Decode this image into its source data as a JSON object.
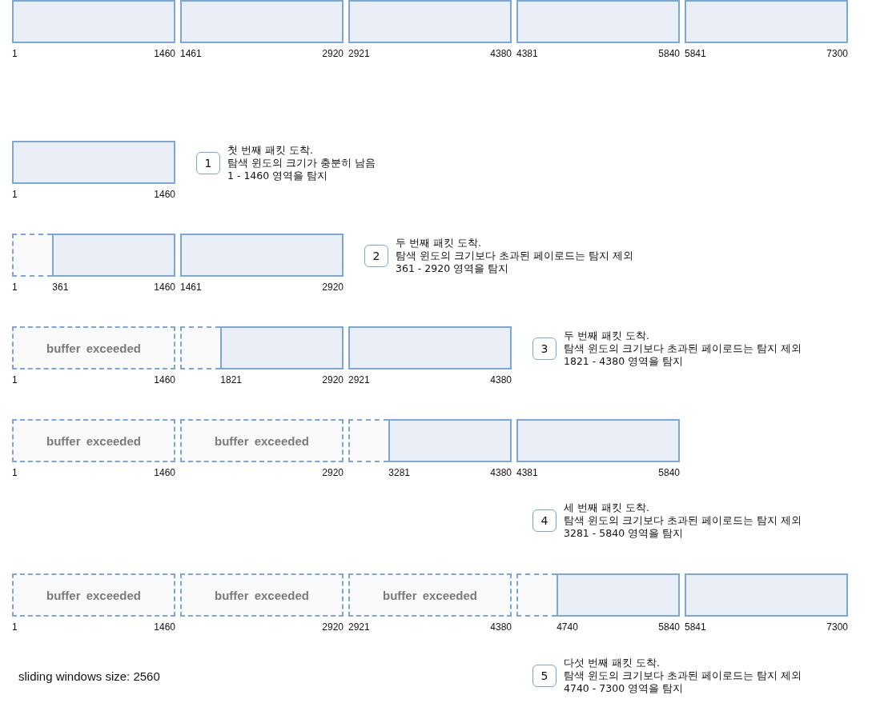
{
  "rows": [
    {
      "segments": [
        {
          "kind": "packet",
          "start": "1",
          "end": "1460"
        },
        {
          "kind": "packet",
          "start": "1461",
          "end": "2920"
        },
        {
          "kind": "packet",
          "start": "2921",
          "end": "4380"
        },
        {
          "kind": "packet",
          "start": "4381",
          "end": "5840"
        },
        {
          "kind": "packet",
          "start": "5841",
          "end": "7300"
        }
      ]
    },
    {
      "segments": [
        {
          "kind": "packet",
          "start": "1",
          "end": "1460"
        }
      ],
      "callout": {
        "kind": "beside",
        "number": "1",
        "lines": [
          "첫 번째 패킷 도착.",
          "탐색 윈도의 크기가 충분히 남음",
          "1 - 1460 영역을 탐지"
        ]
      }
    },
    {
      "segments": [
        {
          "kind": "split",
          "start": "1",
          "cut": "361",
          "end": "1460"
        },
        {
          "kind": "packet",
          "start": "1461",
          "end": "2920"
        }
      ],
      "callout": {
        "kind": "beside",
        "number": "2",
        "lines": [
          "두 번째 패킷 도착.",
          "탐색 윈도의 크기보다 초과된 페이로드는 탐지 제외",
          "361 - 2920 영역을 탐지"
        ]
      }
    },
    {
      "segments": [
        {
          "kind": "exceeded",
          "label": "buffer exceeded",
          "start": "1",
          "end": "1460"
        },
        {
          "kind": "split",
          "cut": "1821",
          "end": "2920"
        },
        {
          "kind": "packet",
          "start": "2921",
          "end": "4380"
        }
      ],
      "callout": {
        "kind": "beside",
        "number": "3",
        "lines": [
          "두 번째 패킷 도착.",
          "탐색 윈도의 크기보다 초과된 페이로드는 탐지 제외",
          "1821 - 4380 영역을 탐지"
        ]
      }
    },
    {
      "segments": [
        {
          "kind": "exceeded",
          "label": "buffer exceeded",
          "start": "1",
          "end": "1460"
        },
        {
          "kind": "exceeded",
          "label": "buffer exceeded",
          "end": "2920"
        },
        {
          "kind": "split",
          "cut": "3281",
          "end": "4380"
        },
        {
          "kind": "packet",
          "start": "4381",
          "end": "5840"
        }
      ],
      "callout": {
        "kind": "below",
        "number": "4",
        "lines": [
          "세 번째 패킷 도착.",
          "탐색 윈도의 크기보다 초과된 페이로드는 탐지 제외",
          "3281 - 5840 영역을 탐지"
        ]
      }
    },
    {
      "segments": [
        {
          "kind": "exceeded",
          "label": "buffer exceeded",
          "start": "1",
          "end": "1460"
        },
        {
          "kind": "exceeded",
          "label": "buffer exceeded",
          "end": "2920"
        },
        {
          "kind": "exceeded",
          "label": "buffer exceeded",
          "start": "2921",
          "end": "4380"
        },
        {
          "kind": "split",
          "cut": "4740",
          "end": "5840"
        },
        {
          "kind": "packet",
          "start": "5841",
          "end": "7300"
        }
      ],
      "callout": {
        "kind": "below",
        "number": "5",
        "lines": [
          "다섯 번째 패킷 도착.",
          "탐색 윈도의 크기보다 초과된 페이로드는 탐지 제외",
          "4740 - 7300 영역을 탐지"
        ]
      }
    }
  ],
  "window_size_note": "sliding windows size: 2560"
}
